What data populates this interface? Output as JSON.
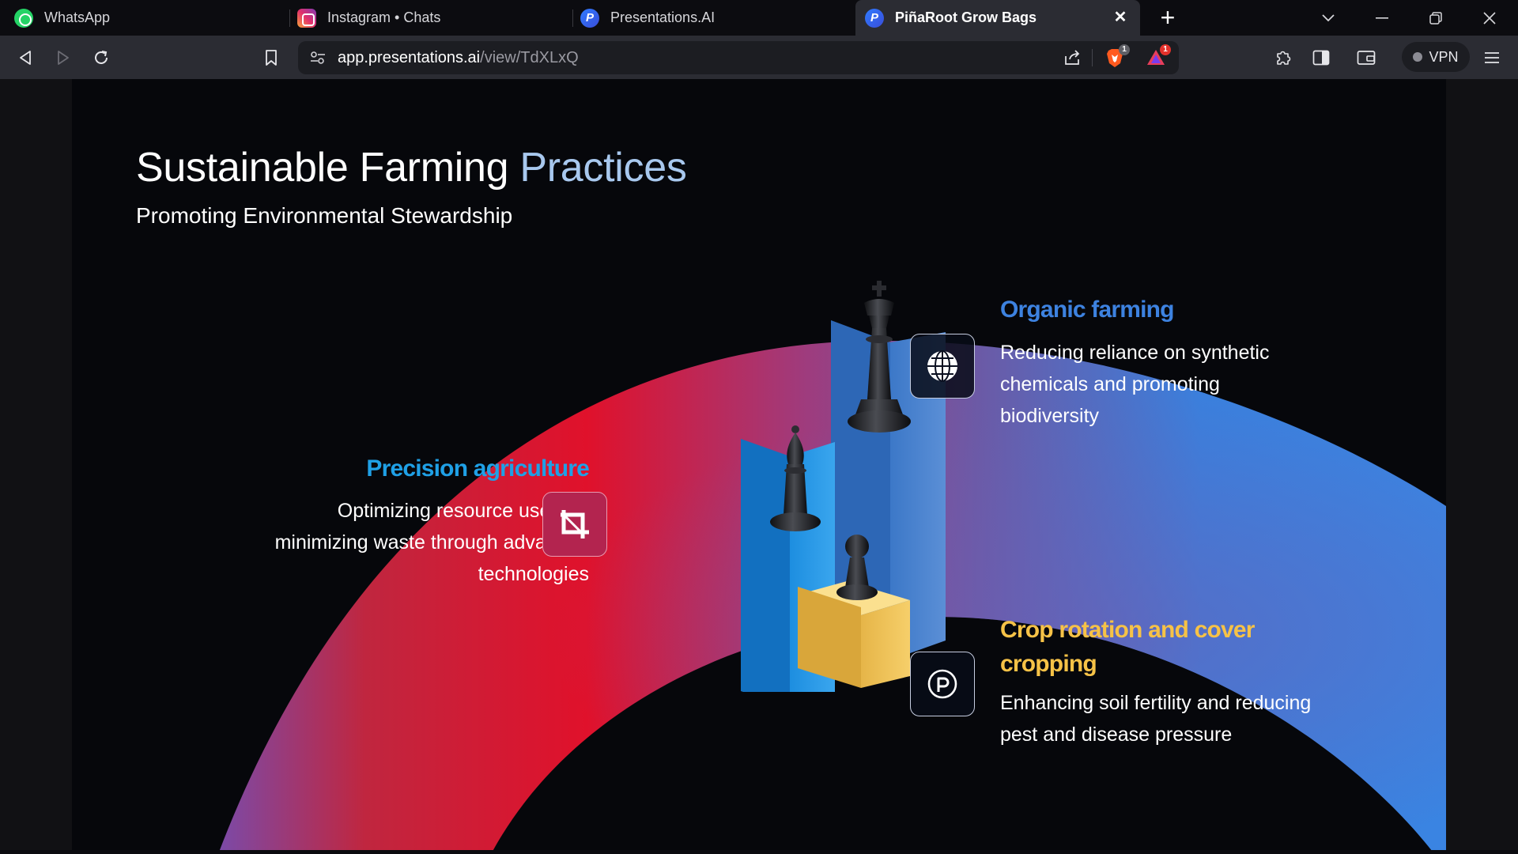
{
  "browser": {
    "tabs": [
      {
        "label": "WhatsApp",
        "icon": "whatsapp-icon"
      },
      {
        "label": "Instagram • Chats",
        "icon": "instagram-icon"
      },
      {
        "label": "Presentations.AI",
        "icon": "presentations-ai-icon"
      },
      {
        "label": "PiñaRoot Grow Bags",
        "icon": "presentations-ai-icon",
        "active": true
      }
    ],
    "url_host": "app.presentations.ai",
    "url_path": "/view/TdXLxQ",
    "shields_badge": "1",
    "rewards_badge": "1",
    "vpn_label": "VPN"
  },
  "slide": {
    "title_main": "Sustainable Farming",
    "title_accent": "Practices",
    "subtitle": "Promoting Environmental Stewardship",
    "items": [
      {
        "heading": "Organic farming",
        "text": "Reducing reliance on synthetic chemicals and promoting biodiversity",
        "color": "#3d82e0",
        "icon": "globe-icon"
      },
      {
        "heading": "Precision agriculture",
        "text": "Optimizing resource use and minimizing waste through advanced technologies",
        "color": "#1fa0e6",
        "icon": "crop-icon"
      },
      {
        "heading": "Crop rotation and cover cropping",
        "text": "Enhancing soil fertility and reducing pest and disease pressure",
        "color": "#f6c247",
        "icon": "circle-p-icon"
      }
    ]
  },
  "colors": {
    "background": "#06070b",
    "arc_red": "#e0112b",
    "arc_purple": "#8a4d9e",
    "arc_blue": "#3a7fdc",
    "pillar_blue": "#2f8fe0",
    "pillar_yellow": "#f2c14e"
  }
}
